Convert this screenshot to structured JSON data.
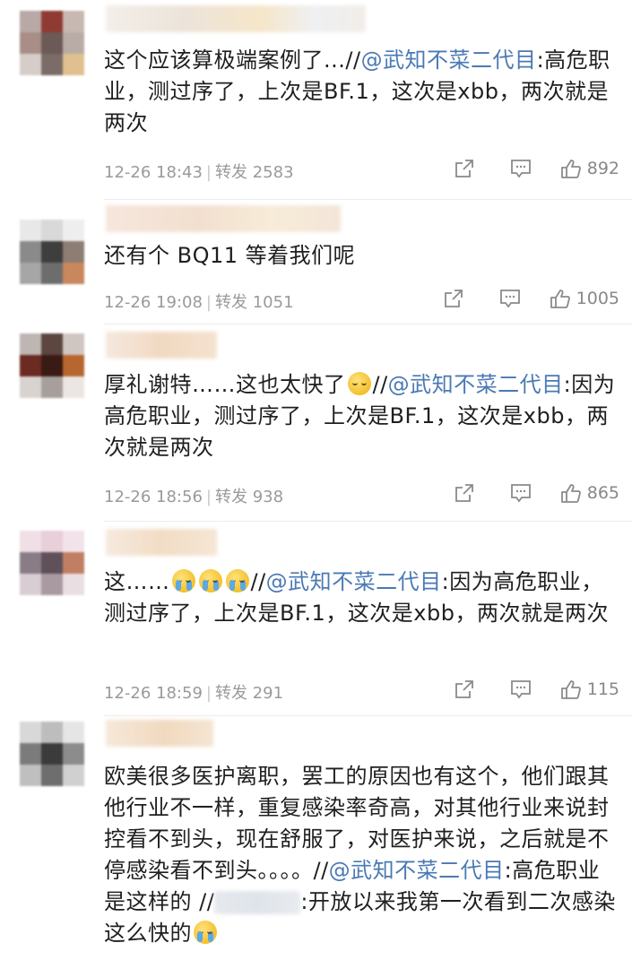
{
  "comments": [
    {
      "body_pre": "这个应该算极端案例了...//",
      "mention": "@武知不菜二代目",
      "body_post": ":高危职业，测过序了，上次是BF.1，这次是xbb，两次就是两次",
      "time": "12-26 18:43",
      "repost_label": "转发",
      "repost_count": "2583",
      "like_count": "892"
    },
    {
      "body_pre": "还有个 BQ11 等着我们呢",
      "time": "12-26 19:08",
      "repost_label": "转发",
      "repost_count": "1051",
      "like_count": "1005"
    },
    {
      "body_pre": "厚礼谢特……这也太快了",
      "body_mid": "//",
      "mention": "@武知不菜二代目",
      "body_post": ":因为高危职业，测过序了，上次是BF.1，这次是xbb，两次就是两次",
      "time": "12-26 18:56",
      "repost_label": "转发",
      "repost_count": "938",
      "like_count": "865"
    },
    {
      "body_pre": "这……",
      "body_mid": "//",
      "mention": "@武知不菜二代目",
      "body_post": ":因为高危职业，测过序了，上次是BF.1，这次是xbb，两次就是两次",
      "time": "12-26 18:59",
      "repost_label": "转发",
      "repost_count": "291",
      "like_count": "115"
    },
    {
      "body_pre": "欧美很多医护离职，罢工的原因也有这个，他们跟其他行业不一样，重复感染率奇高，对其他行业来说封控看不到头，现在舒服了，对医护来说，之后就是不停感染看不到头。。。。//",
      "mention": "@武知不菜二代目",
      "body_post": ":高危职业是这样的 //",
      "body_tail": ":开放以来我第一次看到二次感染这么快的"
    }
  ],
  "icons": {
    "share": "share-icon",
    "comment": "comment-icon",
    "like": "thumbs-up-icon"
  },
  "colors": {
    "mention": "#4a79b4",
    "meta": "#9a9a9a"
  }
}
